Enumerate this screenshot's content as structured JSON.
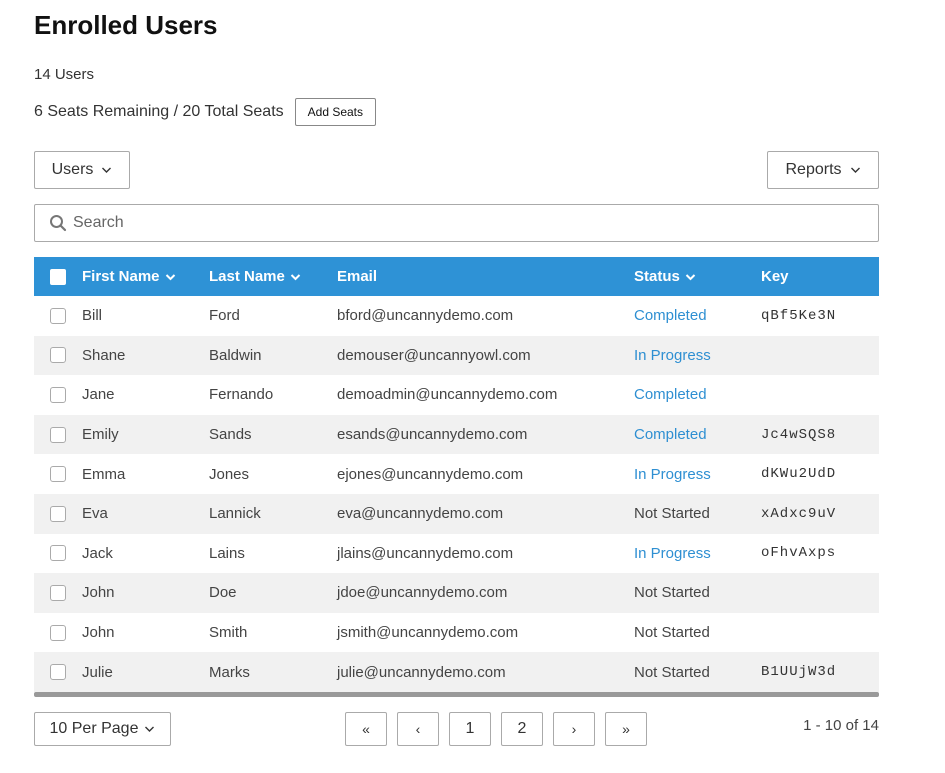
{
  "header": {
    "title": "Enrolled Users",
    "user_count": "14 Users",
    "seats_text": "6 Seats Remaining / 20 Total Seats",
    "add_seats_label": "Add Seats"
  },
  "toolbar": {
    "users_label": "Users",
    "reports_label": "Reports"
  },
  "search": {
    "placeholder": "Search",
    "value": ""
  },
  "table": {
    "columns": {
      "first_name": "First Name",
      "last_name": "Last Name",
      "email": "Email",
      "status": "Status",
      "key": "Key"
    },
    "rows": [
      {
        "first": "Bill",
        "last": "Ford",
        "email": "bford@uncannydemo.com",
        "status": "Completed",
        "key": "qBf5Ke3N"
      },
      {
        "first": "Shane",
        "last": "Baldwin",
        "email": "demouser@uncannyowl.com",
        "status": "In Progress",
        "key": ""
      },
      {
        "first": "Jane",
        "last": "Fernando",
        "email": "demoadmin@uncannydemo.com",
        "status": "Completed",
        "key": ""
      },
      {
        "first": "Emily",
        "last": "Sands",
        "email": "esands@uncannydemo.com",
        "status": "Completed",
        "key": "Jc4wSQS8"
      },
      {
        "first": "Emma",
        "last": "Jones",
        "email": "ejones@uncannydemo.com",
        "status": "In Progress",
        "key": "dKWu2UdD"
      },
      {
        "first": "Eva",
        "last": "Lannick",
        "email": "eva@uncannydemo.com",
        "status": "Not Started",
        "key": "xAdxc9uV"
      },
      {
        "first": "Jack",
        "last": "Lains",
        "email": "jlains@uncannydemo.com",
        "status": "In Progress",
        "key": "oFhvAxps"
      },
      {
        "first": "John",
        "last": "Doe",
        "email": "jdoe@uncannydemo.com",
        "status": "Not Started",
        "key": ""
      },
      {
        "first": "John",
        "last": "Smith",
        "email": "jsmith@uncannydemo.com",
        "status": "Not Started",
        "key": ""
      },
      {
        "first": "Julie",
        "last": "Marks",
        "email": "julie@uncannydemo.com",
        "status": "Not Started",
        "key": "B1UUjW3d"
      }
    ]
  },
  "pagination": {
    "per_page_label": "10 Per Page",
    "first": "«",
    "prev": "‹",
    "pages": [
      "1",
      "2"
    ],
    "next": "›",
    "last": "»",
    "range_text": "1 - 10 of 14"
  },
  "colors": {
    "accent": "#2e92d6",
    "link": "#2e8fd2"
  },
  "icons": {
    "search": "search-icon",
    "dropdown": "chevron-down-icon"
  }
}
